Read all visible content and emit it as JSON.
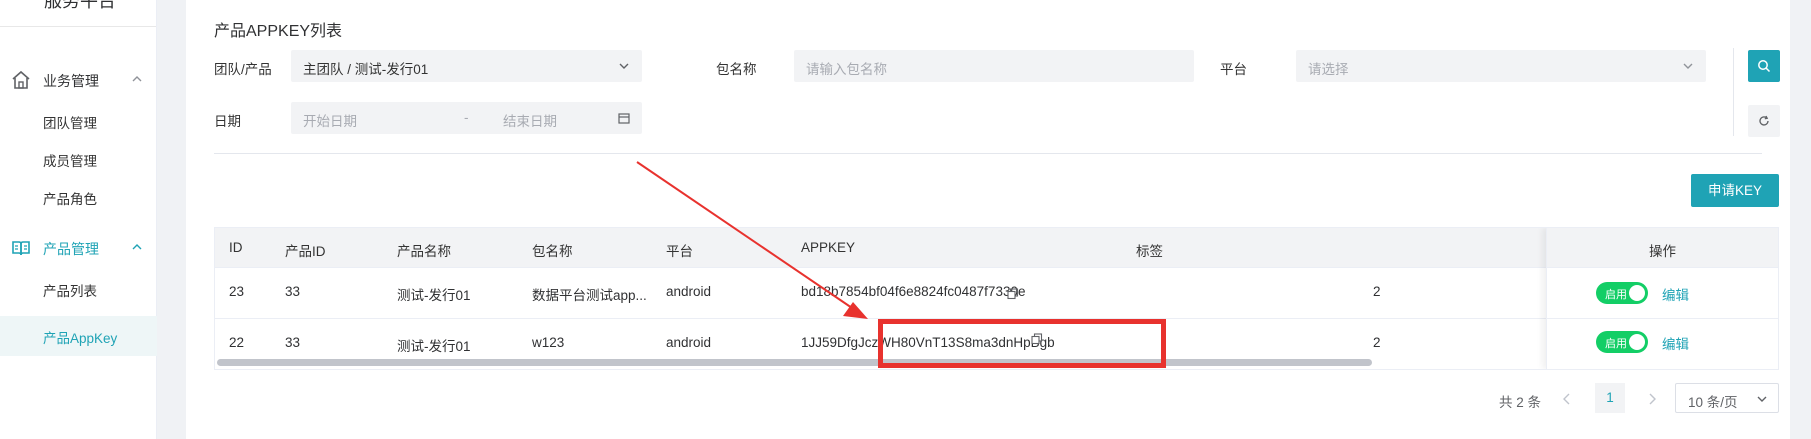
{
  "sidebar": {
    "brand": "服务平台",
    "groups": [
      {
        "label": "业务管理",
        "items": [
          "团队管理",
          "成员管理",
          "产品角色"
        ]
      },
      {
        "label": "产品管理",
        "items": [
          "产品列表",
          "产品AppKey"
        ]
      }
    ],
    "active_item": "产品AppKey",
    "accent_color": "#1fa3b5"
  },
  "page": {
    "title": "产品APPKEY列表"
  },
  "filters": {
    "team_label": "团队/产品",
    "team_value": "主团队 / 测试-发行01",
    "pkg_label": "包名称",
    "pkg_placeholder": "请输入包名称",
    "platform_label": "平台",
    "platform_placeholder": "请选择",
    "date_label": "日期",
    "date_start_placeholder": "开始日期",
    "date_separator": "-",
    "date_end_placeholder": "结束日期"
  },
  "actions": {
    "apply_key": "申请KEY"
  },
  "table": {
    "columns": [
      "ID",
      "产品ID",
      "产品名称",
      "包名称",
      "平台",
      "APPKEY",
      "标签",
      "操作"
    ],
    "rows": [
      {
        "id": "23",
        "product_id": "33",
        "product_name": "测试-发行01",
        "package": "数据平台测试app...",
        "platform": "android",
        "appkey": "bd18b7854bf04f6e8824fc0487f7330e",
        "tag": "",
        "status": "启用",
        "edit": "编辑"
      },
      {
        "id": "22",
        "product_id": "33",
        "product_name": "测试-发行01",
        "package": "w123",
        "platform": "android",
        "appkey": "1JJ59DfgJczWH80VnT13S8ma3dnHpBgb",
        "tag": "",
        "status": "启用",
        "edit": "编辑"
      }
    ],
    "partial_col_values": [
      "2",
      "2"
    ]
  },
  "pagination": {
    "total_text": "共 2 条",
    "current_page": "1",
    "page_size": "10 条/页"
  },
  "annotation": {
    "color": "#e8322e",
    "highlighted_value": "1JJ59DfgJczWH80VnT13S8ma3dnHpBgb"
  }
}
